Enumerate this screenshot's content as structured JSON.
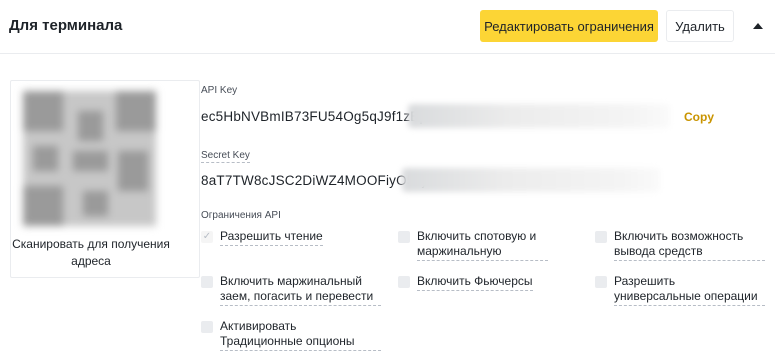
{
  "header": {
    "title": "Для терминала",
    "edit_button": "Редактировать ограничения",
    "delete_button": "Удалить"
  },
  "qr": {
    "caption": "Сканировать для получения адреса"
  },
  "api_key": {
    "label": "API Key",
    "value": "ec5HbNVBmIB73FU54Og5qJ9f1zEp",
    "copy_label": "Copy"
  },
  "secret_key": {
    "label": "Secret Key",
    "value": "8aT7TW8cJSC2DiWZ4MOOFiyO57js"
  },
  "restrictions": {
    "label": "Ограничения API",
    "options": [
      {
        "label": "Разрешить чтение",
        "checked": true
      },
      {
        "label": "Включить спотовую и маржинальную",
        "checked": false
      },
      {
        "label": "Включить возможность вывода средств",
        "checked": false
      },
      {
        "label": "Включить маржинальный заем, погасить и перевести",
        "checked": false
      },
      {
        "label": "Включить Фьючерсы",
        "checked": false
      },
      {
        "label": "Разрешить универсальные операции",
        "checked": false
      },
      {
        "label": "Активировать Традиционные опционы",
        "checked": false
      }
    ]
  },
  "colors": {
    "accent": "#fcd535",
    "copy": "#c99400",
    "text": "#1e2329"
  }
}
